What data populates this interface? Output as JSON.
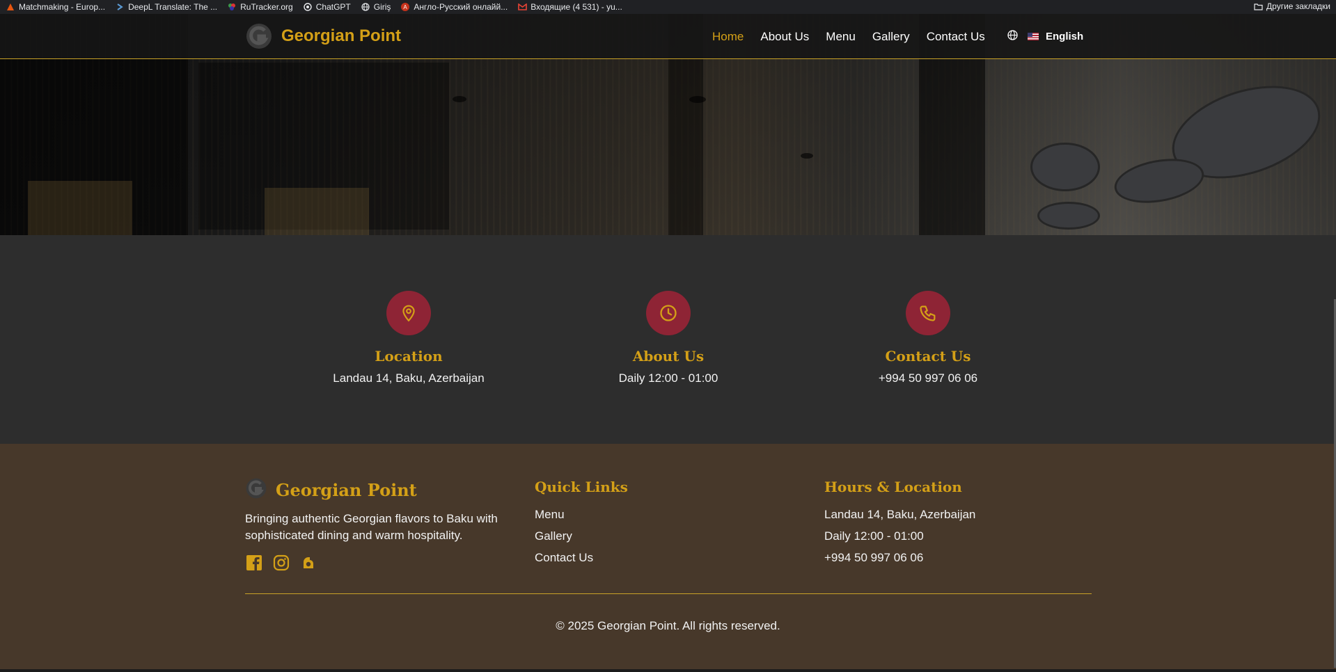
{
  "bookmarks": [
    {
      "label": "Matchmaking - Europ...",
      "icon": "orange-flame-icon",
      "color": "#e8560f"
    },
    {
      "label": "DeepL Translate: The ...",
      "icon": "deepl-icon",
      "color": "#5b9bd5"
    },
    {
      "label": "RuTracker.org",
      "icon": "rutracker-icon",
      "color": "#3a9a4a"
    },
    {
      "label": "ChatGPT",
      "icon": "chatgpt-icon",
      "color": "#e8eaed"
    },
    {
      "label": "Giriş",
      "icon": "globe-icon",
      "color": "#e8eaed"
    },
    {
      "label": "Англо-Русский онлайй...",
      "icon": "translate-icon",
      "color": "#c5321b"
    },
    {
      "label": "Входящие (4 531) - yu...",
      "icon": "gmail-icon",
      "color": "#ea4335"
    }
  ],
  "other_bookmarks": "Другие закладки",
  "nav": {
    "brand": "Georgian Point",
    "items": [
      {
        "label": "Home",
        "active": true
      },
      {
        "label": "About Us",
        "active": false
      },
      {
        "label": "Menu",
        "active": false
      },
      {
        "label": "Gallery",
        "active": false
      },
      {
        "label": "Contact Us",
        "active": false
      }
    ],
    "language": "English"
  },
  "info": [
    {
      "icon": "map-pin-icon",
      "title": "Location",
      "text": "Landau 14, Baku, Azerbaijan"
    },
    {
      "icon": "clock-icon",
      "title": "About Us",
      "text": "Daily 12:00 - 01:00"
    },
    {
      "icon": "phone-icon",
      "title": "Contact Us",
      "text": "+994 50 997 06 06"
    }
  ],
  "footer": {
    "brand": "Georgian Point",
    "description": "Bringing authentic Georgian flavors to Baku with sophisticated dining and warm hospitality.",
    "socials": [
      "facebook-icon",
      "instagram-icon",
      "wolt-icon"
    ],
    "quick_links": {
      "title": "Quick Links",
      "items": [
        "Menu",
        "Gallery",
        "Contact Us"
      ]
    },
    "hours_location": {
      "title": "Hours & Location",
      "items": [
        "Landau 14, Baku, Azerbaijan",
        "Daily 12:00 - 01:00",
        "+994 50 997 06 06"
      ]
    },
    "copyright": "© 2025 Georgian Point. All rights reserved."
  },
  "colors": {
    "gold": "#d4a017",
    "burgundy": "#8e2435",
    "footer_bg": "#47382a",
    "info_bg": "#2d2d2d"
  }
}
